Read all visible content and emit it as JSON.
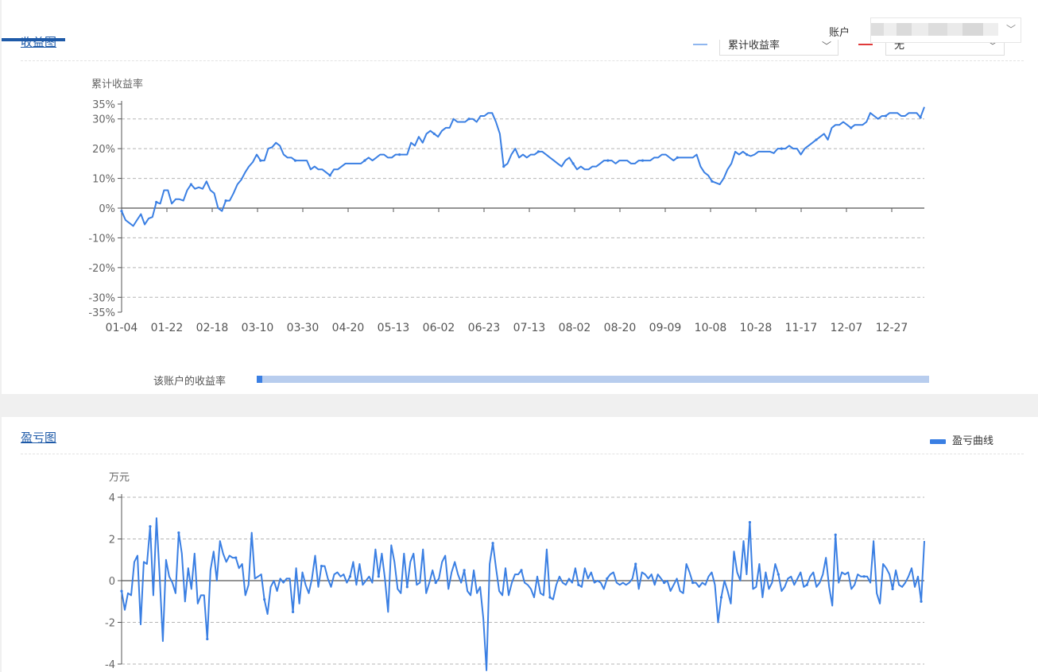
{
  "account": {
    "label": "账户"
  },
  "panel1": {
    "title": "收益图",
    "select1_value": "累计收益率",
    "select2_value": "无",
    "slider_label": "该账户的收益率"
  },
  "panel2": {
    "title": "盈亏图",
    "legend_label": "盈亏曲线"
  },
  "colors": {
    "series": "#3a7fe3",
    "red_legend": "#e03a3a",
    "link": "#1e5aa8"
  },
  "chart_data": [
    {
      "type": "line",
      "ylabel": "累计收益率",
      "ylim": [
        -35,
        35
      ],
      "yticks": [
        -35,
        -30,
        -20,
        -10,
        0,
        10,
        20,
        30,
        35
      ],
      "ytick_labels": [
        "-35%",
        "-30%",
        "-20%",
        "-10%",
        "0%",
        "10%",
        "20%",
        "30%",
        "35%"
      ],
      "categories": [
        "01-04",
        "01-22",
        "02-18",
        "03-10",
        "03-30",
        "04-20",
        "05-13",
        "06-02",
        "06-23",
        "07-13",
        "08-02",
        "08-20",
        "09-09",
        "10-08",
        "10-28",
        "11-17",
        "12-07",
        "12-27"
      ],
      "grid": true,
      "series": [
        {
          "values": [
            -1,
            -4,
            -5,
            -6,
            -4,
            -2,
            -5.5,
            -3.5,
            -3,
            2,
            1.5,
            6,
            6,
            1.5,
            3,
            3,
            2.5,
            6,
            8,
            6.5,
            7,
            6.5,
            9,
            6,
            5,
            0,
            -1,
            2.5,
            2.5,
            5,
            8,
            9.5,
            12,
            14,
            15.5,
            18,
            16,
            16,
            20,
            20.5,
            22,
            21,
            18,
            17,
            17,
            16,
            16,
            16,
            16,
            13,
            14,
            13,
            13,
            12,
            11,
            13,
            13,
            14,
            15,
            15,
            15,
            15,
            15,
            16,
            17,
            16,
            17,
            18,
            18,
            17,
            17,
            18,
            18,
            18,
            18,
            22,
            21,
            24,
            22,
            25,
            26,
            25,
            24,
            26,
            27,
            27,
            30,
            29,
            29,
            29,
            30,
            30,
            29,
            31,
            31,
            32,
            32,
            29,
            25,
            14,
            15,
            18,
            20,
            17,
            18,
            17,
            18,
            18,
            19,
            19,
            18,
            17,
            16,
            15,
            14,
            16,
            17,
            15,
            13,
            14,
            13,
            13,
            14,
            14,
            15,
            16,
            16,
            16,
            15,
            16,
            16,
            16,
            15,
            15,
            16,
            16,
            16,
            16,
            17,
            17,
            18,
            18,
            17,
            16,
            17,
            17,
            17,
            17,
            17,
            18,
            14,
            12,
            11,
            9,
            8.5,
            8,
            10,
            13,
            15,
            19,
            18,
            19,
            18,
            17.5,
            18,
            19,
            19,
            19,
            19,
            18.5,
            20,
            20,
            20,
            21,
            20,
            20,
            18,
            20,
            21,
            22,
            23,
            24,
            25,
            23,
            27,
            28,
            28,
            29,
            28,
            27,
            28,
            28,
            28,
            29,
            32,
            31,
            30,
            31,
            31,
            32,
            32,
            32,
            31,
            31,
            32,
            32,
            32,
            30.5,
            34
          ]
        }
      ]
    },
    {
      "type": "line",
      "ylabel": "万元",
      "ylim": [
        -4,
        4
      ],
      "yticks": [
        -4,
        -2,
        0,
        2,
        4
      ],
      "ytick_labels": [
        "-4",
        "-2",
        "0",
        "2",
        "4"
      ],
      "grid": true,
      "legend": "top-right",
      "series": [
        {
          "name": "盈亏曲线",
          "values": [
            -0.5,
            -1.4,
            -0.6,
            -0.7,
            0.9,
            1.2,
            -2.1,
            0.9,
            0.8,
            2.6,
            -0.7,
            3.0,
            0.2,
            -2.9,
            1.0,
            0.2,
            -0.1,
            -0.6,
            2.3,
            1.3,
            -1.0,
            0.6,
            -0.4,
            1.3,
            -1.1,
            -0.7,
            -0.7,
            -2.8,
            0.5,
            1.4,
            0.0,
            1.9,
            1.3,
            0.9,
            1.2,
            1.1,
            1.1,
            0.6,
            0.8,
            -0.7,
            -0.2,
            2.3,
            0.1,
            0.2,
            0.3,
            -0.9,
            -1.6,
            -0.3,
            0.0,
            -0.5,
            0.1,
            -0.1,
            0.1,
            0.1,
            -1.5,
            0.6,
            -1.1,
            0.4,
            -0.2,
            -0.6,
            0.1,
            1.2,
            -0.3,
            0.7,
            0.7,
            0.1,
            -0.3,
            0.3,
            0.4,
            0.2,
            0.3,
            -0.1,
            0.2,
            0.9,
            -0.2,
            0.8,
            -0.2,
            0.0,
            0.2,
            -0.1,
            1.5,
            0.2,
            1.3,
            0.1,
            -1.5,
            1.7,
            0.9,
            -0.4,
            -0.6,
            1.3,
            -0.3,
            0.9,
            1.3,
            -0.2,
            -0.1,
            1.5,
            -0.6,
            -0.1,
            0.5,
            -0.1,
            0.1,
            0.9,
            1.2,
            -0.4,
            0.4,
            0.9,
            0.3,
            -0.1,
            0.5,
            -0.5,
            -0.7,
            0.5,
            -0.6,
            -0.3,
            -1.8,
            -4.3,
            0.8,
            1.8,
            0.6,
            -0.5,
            -0.7,
            0.6,
            -0.7,
            -0.1,
            0.3,
            0.3,
            0.5,
            -0.1,
            -0.2,
            -0.4,
            -0.8,
            0.2,
            -0.6,
            -0.7,
            1.5,
            -0.8,
            -0.9,
            -0.2,
            0.2,
            -0.1,
            -0.2,
            0.1,
            -0.1,
            0.6,
            -0.2,
            -0.3,
            0.6,
            0.1,
            0.4,
            -0.1,
            0.0,
            -0.1,
            -0.4,
            0.1,
            0.3,
            0.4,
            -0.1,
            -0.2,
            -0.1,
            -0.2,
            -0.1,
            0.1,
            0.8,
            -0.4,
            0.4,
            0.3,
            0.1,
            0.3,
            -0.2,
            0.3,
            0.1,
            -0.1,
            0.0,
            -0.5,
            -0.2,
            0.1,
            -0.5,
            -0.6,
            0.8,
            0.4,
            -0.1,
            -0.1,
            -0.3,
            -0.1,
            -0.2,
            0.2,
            0.4,
            -0.2,
            -2.0,
            -0.8,
            0.0,
            -0.5,
            -1.1,
            1.4,
            0.4,
            0.0,
            1.9,
            0.3,
            2.8,
            -0.4,
            -0.3,
            0.8,
            -0.8,
            0.4,
            -0.4,
            -0.1,
            0.8,
            0.3,
            -0.5,
            -0.3,
            0.1,
            0.2,
            -0.2,
            0.1,
            0.4,
            -0.3,
            -0.2,
            0.2,
            0.4,
            -0.3,
            -0.1,
            0.3,
            1.1,
            -0.3,
            -1.2,
            2.2,
            -0.1,
            0.4,
            0.3,
            0.4,
            -0.4,
            -0.2,
            0.3,
            0.2,
            0.2,
            0.2,
            -0.1,
            1.9,
            -0.6,
            -1.1,
            0.8,
            0.6,
            0.3,
            -0.4,
            0.5,
            -0.2,
            -0.3,
            -0.1,
            0.2,
            0.6,
            -0.3,
            0.2,
            -1.0,
            1.9
          ]
        }
      ]
    }
  ]
}
